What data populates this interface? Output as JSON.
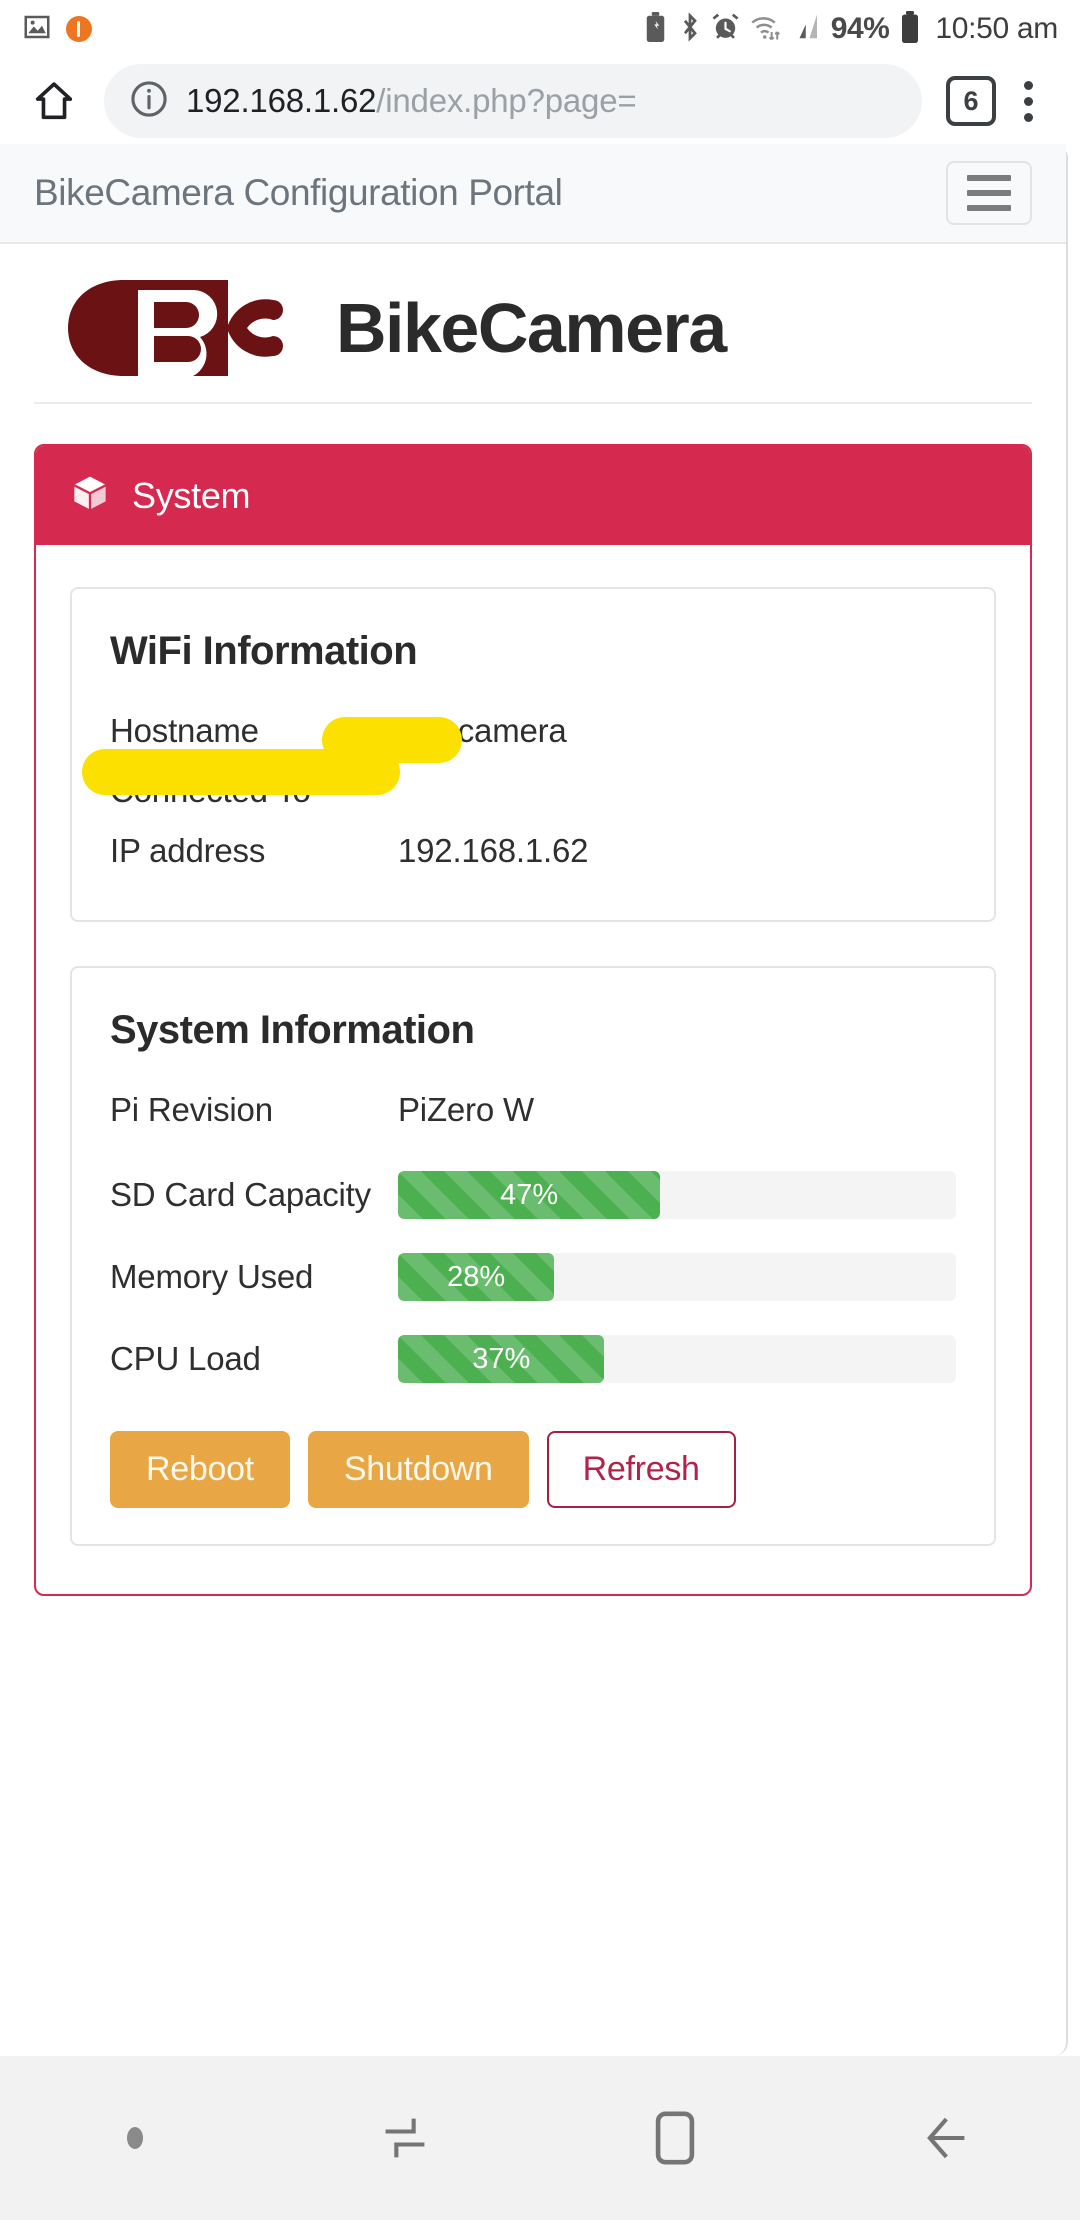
{
  "status_bar": {
    "left_icons": [
      "image-icon",
      "orange-record-icon"
    ],
    "right_icons": [
      "battery-saver-icon",
      "bluetooth-icon",
      "alarm-icon",
      "wifi-icon",
      "signal-icon"
    ],
    "battery_percent": "94%",
    "time": "10:50 am"
  },
  "browser": {
    "home_icon": "home-icon",
    "info_icon": "site-info-icon",
    "url_domain": "192.168.1.62",
    "url_path": "/index.php?page=",
    "tab_count": "6",
    "menu_icon": "overflow-menu-icon"
  },
  "navbar": {
    "brand": "BikeCamera Configuration Portal",
    "toggler_icon": "hamburger-icon"
  },
  "brand": {
    "logo_icon": "bikecamera-bc-logo",
    "logo_color": "#6b1215",
    "title": "BikeCamera"
  },
  "card": {
    "accent_color": "#d6294f",
    "header_icon": "cube-icon",
    "header_title": "System",
    "wifi": {
      "title": "WiFi Information",
      "rows": [
        {
          "key": "Hostname",
          "value": "bikecamera"
        },
        {
          "key": "Connected To",
          "value": ""
        },
        {
          "key": "IP address",
          "value": "192.168.1.62"
        }
      ]
    },
    "system": {
      "title": "System Information",
      "rows": [
        {
          "key": "Pi Revision",
          "value": "PiZero W"
        }
      ],
      "meters": [
        {
          "label": "SD Card Capacity",
          "value": 47,
          "text": "47%",
          "color": "#4caf50"
        },
        {
          "label": "Memory Used",
          "value": 28,
          "text": "28%",
          "color": "#4caf50"
        },
        {
          "label": "CPU Load",
          "value": 37,
          "text": "37%",
          "color": "#4caf50"
        }
      ],
      "buttons": [
        {
          "label": "Reboot",
          "style": "warning"
        },
        {
          "label": "Shutdown",
          "style": "warning"
        },
        {
          "label": "Refresh",
          "style": "outline"
        }
      ]
    }
  },
  "android_nav": {
    "items": [
      "dot-indicator",
      "recents-icon",
      "home-icon",
      "back-icon"
    ]
  }
}
